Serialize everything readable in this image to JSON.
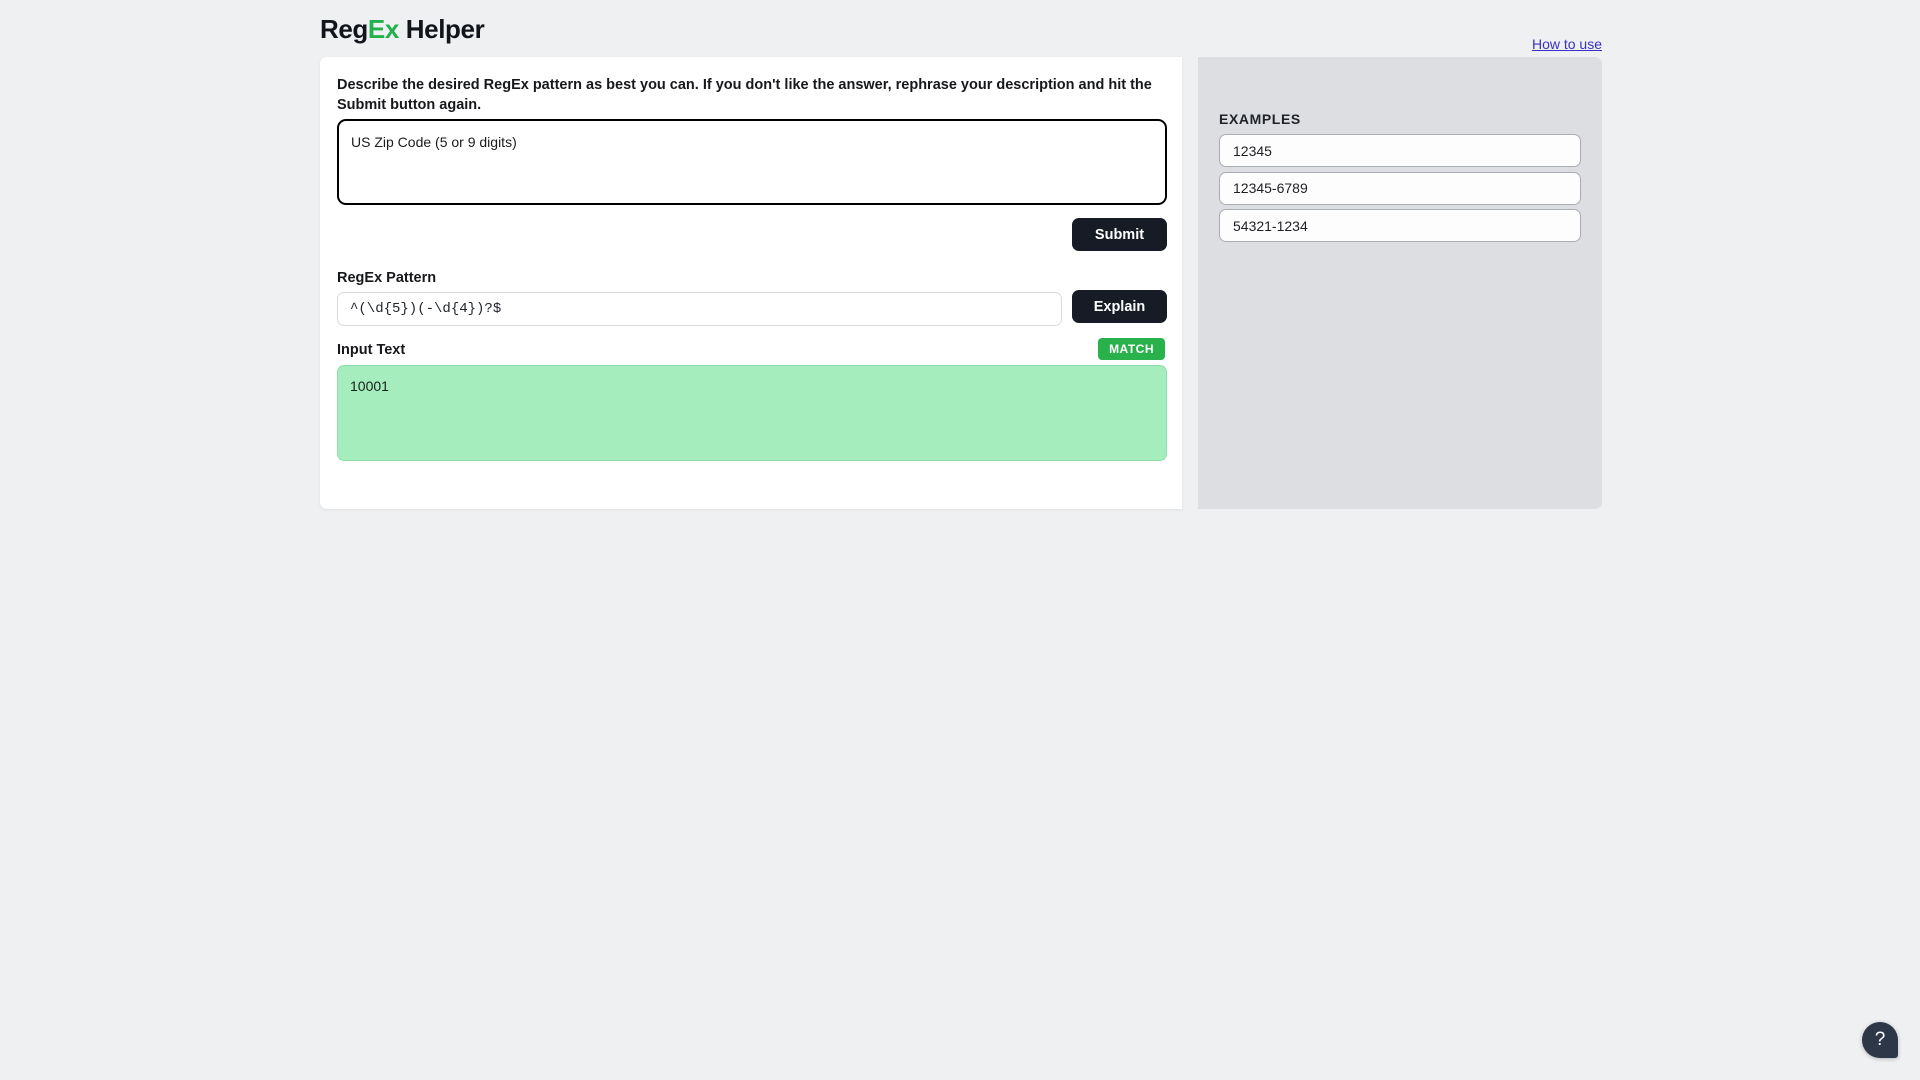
{
  "header": {
    "logo_prefix": "Reg",
    "logo_highlight": "Ex",
    "logo_suffix": " Helper",
    "how_to_use_label": "How to use",
    "link_color": "#3a30c8",
    "highlight_color": "#22b14c"
  },
  "main": {
    "instructions": "Describe the desired RegEx pattern as best you can. If you don't like the answer, rephrase your description and hit the Submit button again.",
    "description_value": "US Zip Code (5 or 9 digits)",
    "description_placeholder": "",
    "submit_label": "Submit",
    "regex_label": "RegEx Pattern",
    "regex_value": "^(\\d{5})(-\\d{4})?$",
    "regex_placeholder": "",
    "explain_label": "Explain",
    "input_text_label": "Input Text",
    "match_badge": "MATCH",
    "match_badge_color": "#29b24b",
    "input_text_value": "10001",
    "input_text_placeholder": "",
    "input_text_bg": "#a5edbc",
    "button_color": "#161b26"
  },
  "side": {
    "title": "EXAMPLES",
    "examples": [
      {
        "value": "12345"
      },
      {
        "value": "12345-6789"
      },
      {
        "value": "54321-1234"
      }
    ]
  },
  "help": {
    "icon": "question-mark-icon",
    "glyph": "?"
  }
}
